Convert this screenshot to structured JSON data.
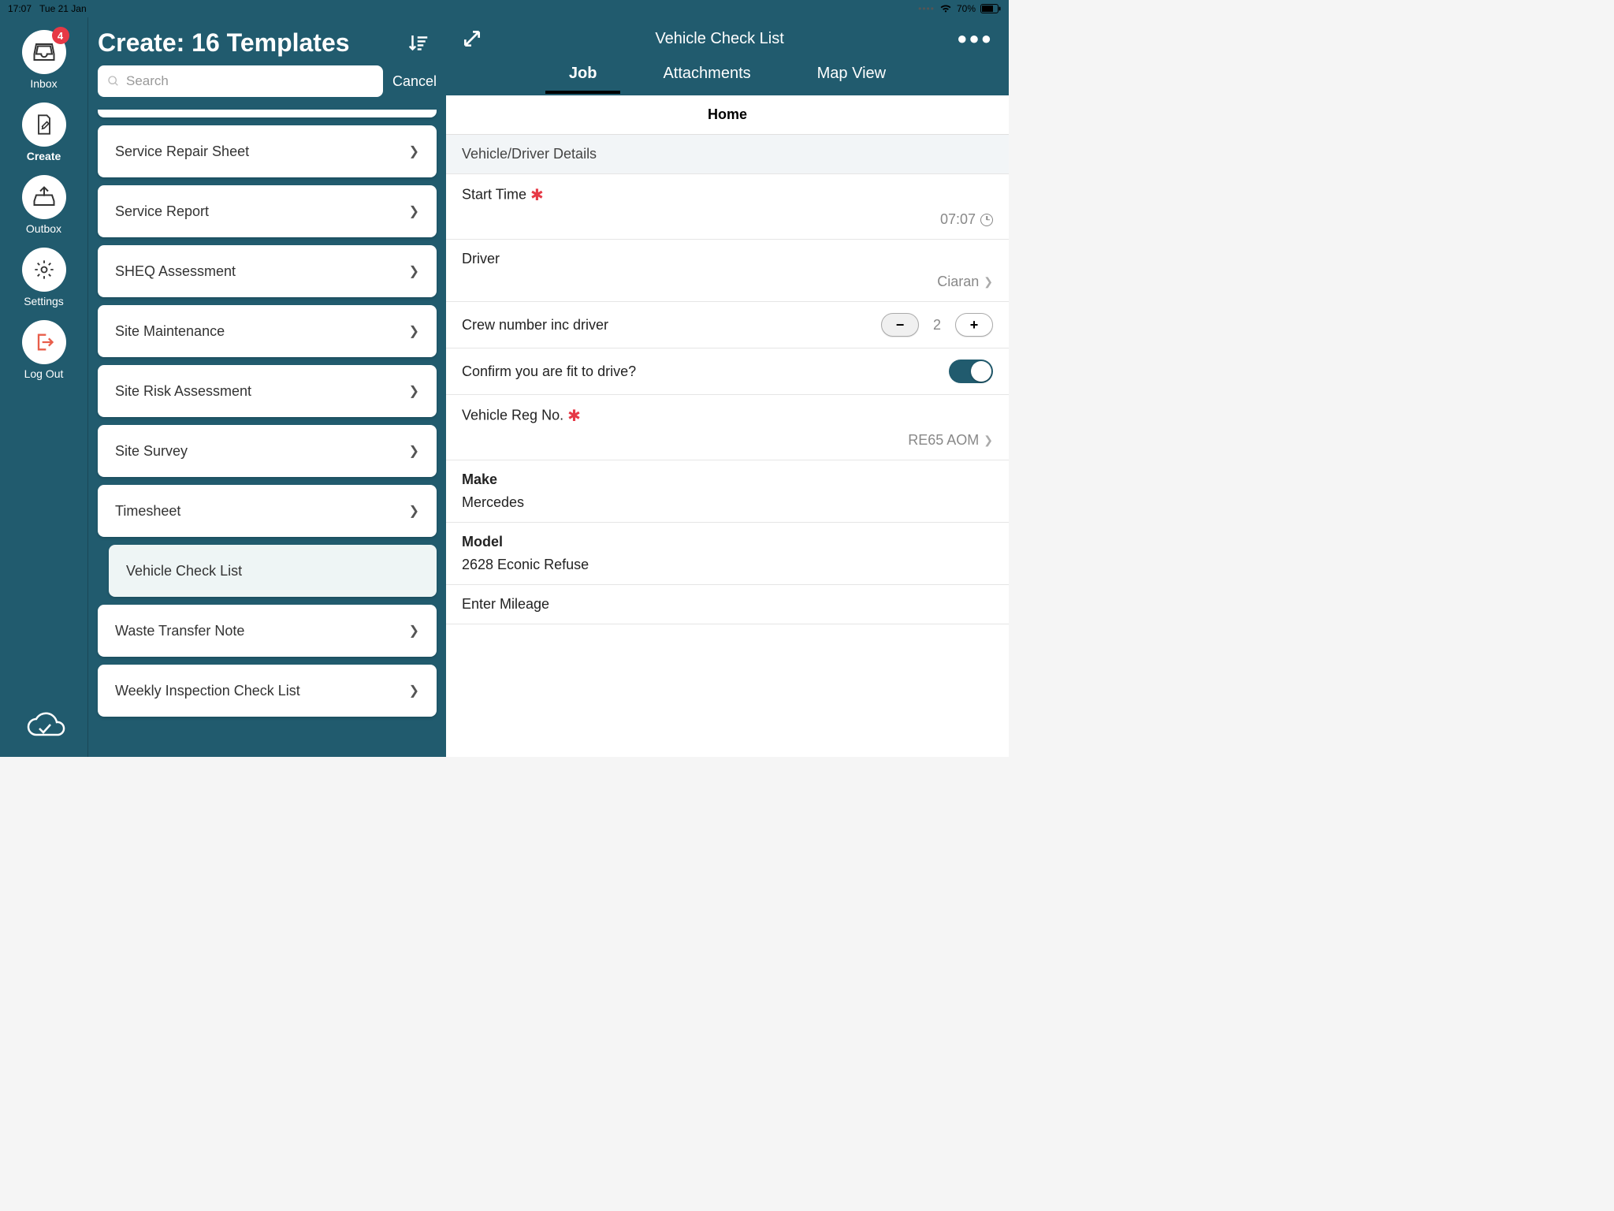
{
  "status": {
    "time": "17:07",
    "date": "Tue 21 Jan",
    "battery": "70%"
  },
  "rail": {
    "items": [
      {
        "label": "Inbox",
        "badge": "4"
      },
      {
        "label": "Create"
      },
      {
        "label": "Outbox"
      },
      {
        "label": "Settings"
      },
      {
        "label": "Log Out"
      }
    ]
  },
  "templates": {
    "title": "Create: 16 Templates",
    "search_placeholder": "Search",
    "cancel": "Cancel",
    "items": [
      {
        "label": "Service Repair Sheet"
      },
      {
        "label": "Service Report"
      },
      {
        "label": "SHEQ Assessment"
      },
      {
        "label": "Site Maintenance"
      },
      {
        "label": "Site Risk Assessment"
      },
      {
        "label": "Site Survey"
      },
      {
        "label": "Timesheet"
      },
      {
        "label": "Vehicle Check List",
        "selected": true
      },
      {
        "label": "Waste Transfer Note"
      },
      {
        "label": "Weekly Inspection Check List"
      }
    ]
  },
  "detail": {
    "title": "Vehicle Check List",
    "tabs": {
      "job": "Job",
      "attachments": "Attachments",
      "map": "Map View"
    },
    "home": "Home",
    "section": "Vehicle/Driver Details",
    "fields": {
      "start_time": {
        "label": "Start Time",
        "value": "07:07"
      },
      "driver": {
        "label": "Driver",
        "value": "Ciaran"
      },
      "crew": {
        "label": "Crew number inc driver",
        "value": "2"
      },
      "fit": {
        "label": "Confirm you are fit to drive?"
      },
      "reg": {
        "label": "Vehicle Reg No.",
        "value": "RE65 AOM"
      },
      "make": {
        "label": "Make",
        "value": "Mercedes"
      },
      "model": {
        "label": "Model",
        "value": "2628 Econic Refuse"
      },
      "mileage": {
        "label": "Enter Mileage"
      }
    }
  }
}
